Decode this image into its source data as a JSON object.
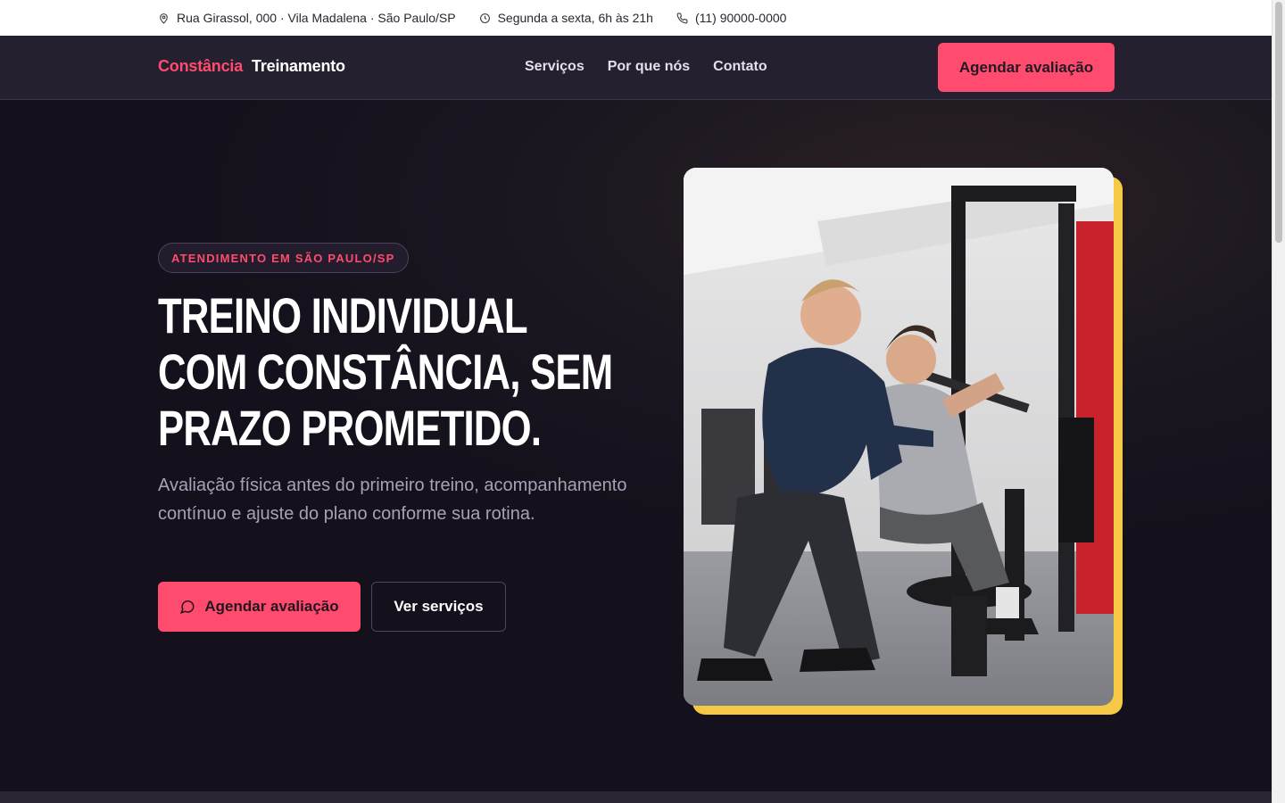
{
  "topbar": {
    "address": "Rua Girassol, 000 · Vila Madalena · São Paulo/SP",
    "hours": "Segunda a sexta, 6h às 21h",
    "phone": "(11) 90000-0000"
  },
  "nav": {
    "logo_primary": "Constância",
    "logo_secondary": "Treinamento",
    "links": [
      "Serviços",
      "Por que nós",
      "Contato"
    ],
    "cta": "Agendar avaliação"
  },
  "hero": {
    "badge": "ATENDIMENTO EM SÃO PAULO/SP",
    "headline_lines": [
      "TREINO INDIVIDUAL",
      "COM CONSTÂNCIA, SEM",
      "PRAZO PROMETIDO."
    ],
    "subtitle": "Avaliação física antes do primeiro treino, acompanhamento contínuo e ajuste do plano conforme sua rotina.",
    "primary_button": "Agendar avaliação",
    "secondary_button": "Ver serviços"
  },
  "colors": {
    "accent": "#ff4b6e",
    "highlight": "#f6c945",
    "nav_bg": "#25202f",
    "hero_bg": "#17131f"
  },
  "icons": {
    "address": "map-pin-icon",
    "hours": "clock-icon",
    "phone": "phone-icon",
    "primary_button": "chat-bubble-icon"
  }
}
